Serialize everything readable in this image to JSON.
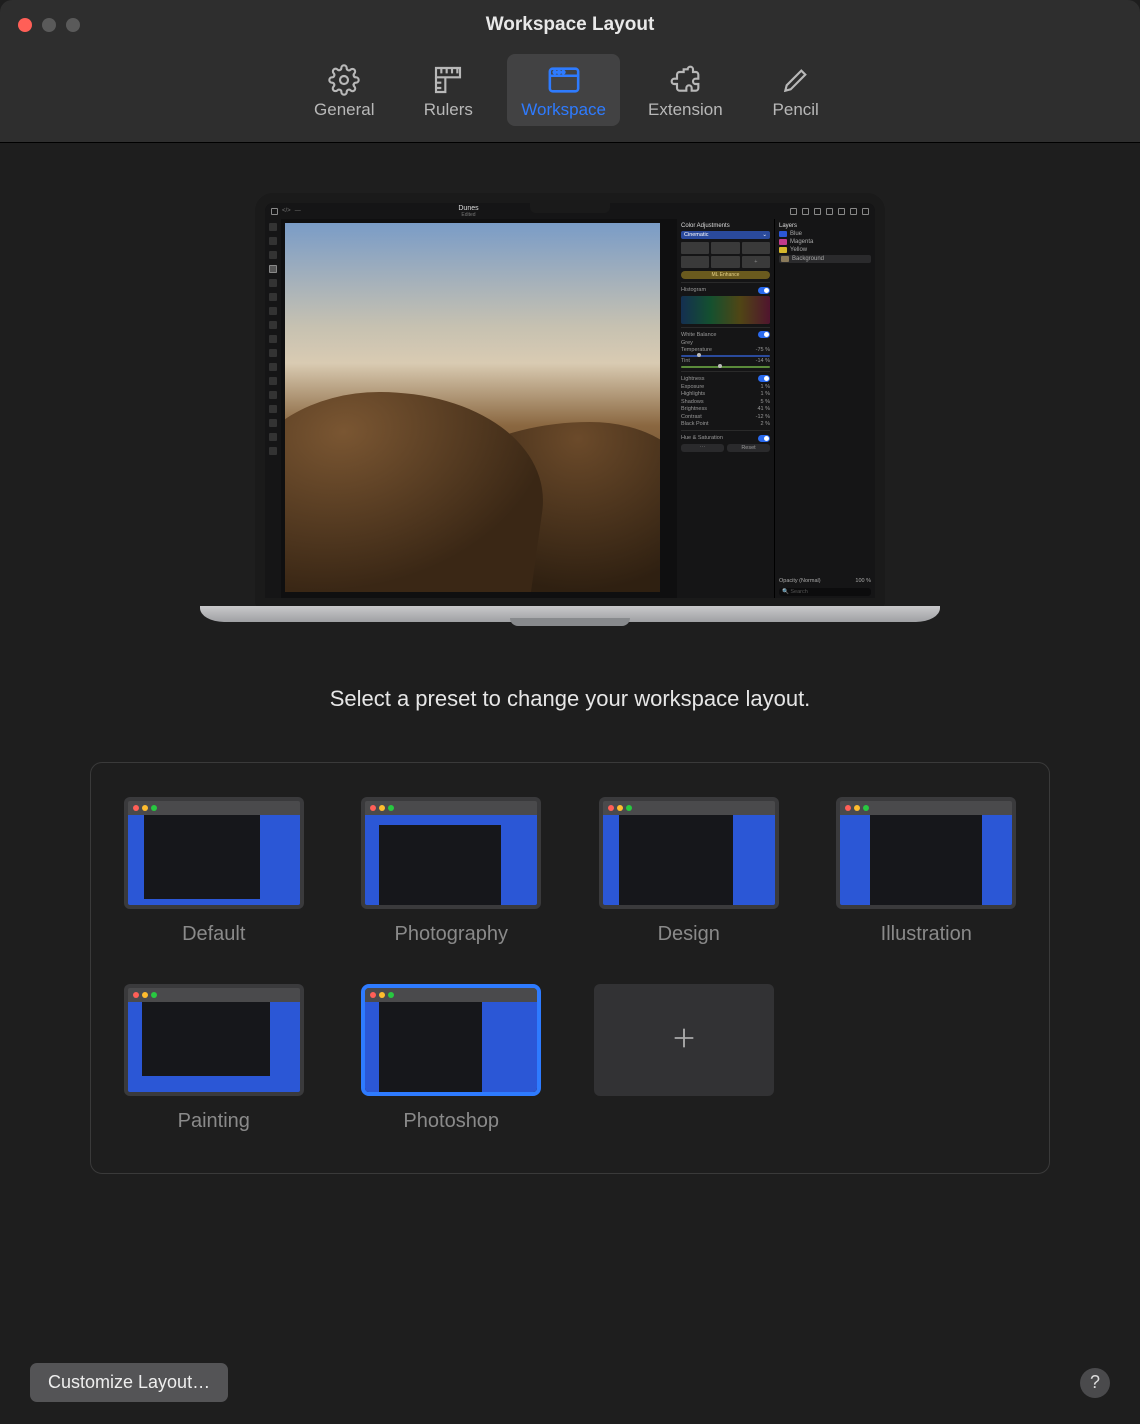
{
  "window": {
    "title": "Workspace Layout"
  },
  "tabs": [
    {
      "id": "general",
      "label": "General",
      "active": false
    },
    {
      "id": "rulers",
      "label": "Rulers",
      "active": false
    },
    {
      "id": "workspace",
      "label": "Workspace",
      "active": true
    },
    {
      "id": "extension",
      "label": "Extension",
      "active": false
    },
    {
      "id": "pencil",
      "label": "Pencil",
      "active": false
    }
  ],
  "preview": {
    "document_title": "Dunes",
    "document_subtitle": "Edited",
    "panels": {
      "color_adjustments": {
        "title": "Color Adjustments",
        "preset": "Cinematic",
        "ml_button": "ML Enhance"
      },
      "histogram": {
        "title": "Histogram",
        "enabled": true
      },
      "white_balance": {
        "title": "White Balance",
        "mode": "Grey",
        "temperature": {
          "label": "Temperature",
          "value": "-75 %"
        },
        "tint": {
          "label": "Tint",
          "value": "-14 %"
        }
      },
      "lightness": {
        "title": "Lightness",
        "exposure": {
          "label": "Exposure",
          "value": "1 %"
        },
        "highlights": {
          "label": "Highlights",
          "value": "1 %"
        },
        "shadows": {
          "label": "Shadows",
          "value": "5 %"
        },
        "brightness": {
          "label": "Brightness",
          "value": "41 %"
        },
        "contrast": {
          "label": "Contrast",
          "value": "-12 %"
        },
        "black_point": {
          "label": "Black Point",
          "value": "2 %"
        }
      },
      "hue_saturation": {
        "title": "Hue & Saturation"
      },
      "reset_button": "Reset",
      "layers": {
        "title": "Layers",
        "items": [
          {
            "name": "Blue",
            "color": "#2b57d6"
          },
          {
            "name": "Magenta",
            "color": "#c23a8a"
          },
          {
            "name": "Yellow",
            "color": "#d6b82b"
          },
          {
            "name": "Background",
            "color": "#8a7a5a"
          }
        ],
        "opacity_label": "Opacity (Normal)",
        "opacity_value": "100 %",
        "search_placeholder": "Search"
      }
    }
  },
  "instruction": "Select a preset to change your workspace layout.",
  "presets": [
    {
      "id": "default",
      "label": "Default",
      "selected": false
    },
    {
      "id": "photography",
      "label": "Photography",
      "selected": false
    },
    {
      "id": "design",
      "label": "Design",
      "selected": false
    },
    {
      "id": "illustration",
      "label": "Illustration",
      "selected": false
    },
    {
      "id": "painting",
      "label": "Painting",
      "selected": false
    },
    {
      "id": "photoshop",
      "label": "Photoshop",
      "selected": true
    }
  ],
  "footer": {
    "customize_button": "Customize Layout…",
    "help_label": "?"
  },
  "colors": {
    "accent": "#2e7bff",
    "panel_blue": "#2b57d6",
    "bg": "#1e1e1e"
  }
}
